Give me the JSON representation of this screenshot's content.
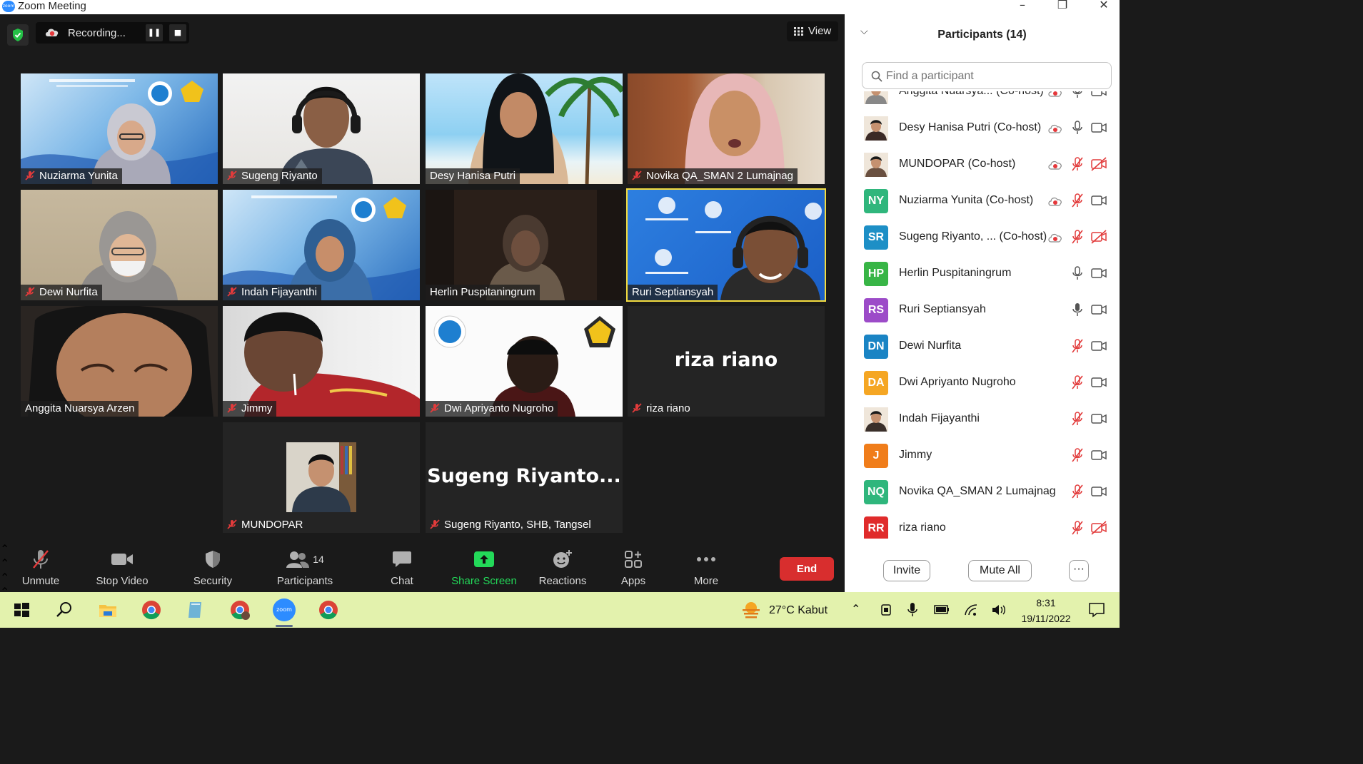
{
  "window": {
    "title": "Zoom Meeting",
    "logo_text": "zoom"
  },
  "meeting": {
    "recording_label": "Recording...",
    "view_label": "View",
    "tiles": [
      {
        "name": "Nuziarma Yunita",
        "muted": true
      },
      {
        "name": "Sugeng Riyanto",
        "muted": true
      },
      {
        "name": "Desy Hanisa Putri",
        "muted": false
      },
      {
        "name": "Novika QA_SMAN 2 Lumajnag",
        "muted": true
      },
      {
        "name": "Dewi Nurfita",
        "muted": true
      },
      {
        "name": "Indah Fijayanthi",
        "muted": true
      },
      {
        "name": "Herlin Puspitaningrum",
        "muted": false
      },
      {
        "name": "Ruri Septiansyah",
        "muted": false,
        "active_speaker": true
      },
      {
        "name": "Anggita Nuarsya Arzen",
        "muted": false
      },
      {
        "name": "Jimmy",
        "muted": true
      },
      {
        "name": "Dwi Apriyanto Nugroho",
        "muted": true
      },
      {
        "name": "riza riano",
        "muted": true,
        "big_label": "riza riano"
      },
      {
        "name": "MUNDOPAR",
        "muted": true
      },
      {
        "name": "Sugeng Riyanto, SHB, Tangsel",
        "muted": true,
        "big_label": "Sugeng  Riyanto..."
      }
    ]
  },
  "toolbar": {
    "unmute": "Unmute",
    "stop_video": "Stop Video",
    "security": "Security",
    "participants": "Participants",
    "participants_count": "14",
    "chat": "Chat",
    "share_screen": "Share Screen",
    "reactions": "Reactions",
    "apps": "Apps",
    "more": "More",
    "end": "End",
    "share_color": "#23d959",
    "end_color": "#d82e2e"
  },
  "panel": {
    "title": "Participants (14)",
    "search_placeholder": "Find a participant",
    "participants": [
      {
        "name": "Anggita Nuarsya...  (Co-host)",
        "initials": "",
        "color": "#888888",
        "photo": true,
        "mic": "on",
        "video": "on",
        "rec": true
      },
      {
        "name": "Desy Hanisa Putri (Co-host)",
        "initials": "",
        "color": "#3b2a26",
        "photo": true,
        "mic": "on",
        "video": "on",
        "rec": true
      },
      {
        "name": "MUNDOPAR (Co-host)",
        "initials": "",
        "color": "#6a5040",
        "photo": true,
        "mic": "muted",
        "video": "off",
        "rec": true
      },
      {
        "name": "Nuziarma Yunita (Co-host)",
        "initials": "NY",
        "color": "#2fb67c",
        "photo": false,
        "mic": "muted",
        "video": "on",
        "rec": true
      },
      {
        "name": "Sugeng Riyanto, ...  (Co-host)",
        "initials": "SR",
        "color": "#1d8fc6",
        "photo": false,
        "mic": "muted",
        "video": "off",
        "rec": true
      },
      {
        "name": "Herlin Puspitaningrum",
        "initials": "HP",
        "color": "#38b546",
        "photo": false,
        "mic": "on",
        "video": "on",
        "rec": false
      },
      {
        "name": "Ruri Septiansyah",
        "initials": "RS",
        "color": "#9c4bc8",
        "photo": false,
        "mic": "speaking",
        "video": "on",
        "rec": false
      },
      {
        "name": "Dewi Nurfita",
        "initials": "DN",
        "color": "#1a84c4",
        "photo": false,
        "mic": "muted",
        "video": "on",
        "rec": false
      },
      {
        "name": "Dwi Apriyanto Nugroho",
        "initials": "DA",
        "color": "#f5a623",
        "photo": false,
        "mic": "muted",
        "video": "on",
        "rec": false
      },
      {
        "name": "Indah Fijayanthi",
        "initials": "",
        "color": "#3a2f2a",
        "photo": true,
        "mic": "muted",
        "video": "on",
        "rec": false
      },
      {
        "name": "Jimmy",
        "initials": "J",
        "color": "#f07d1a",
        "photo": false,
        "mic": "muted",
        "video": "on",
        "rec": false
      },
      {
        "name": "Novika QA_SMAN 2 Lumajnag",
        "initials": "NQ",
        "color": "#2fb67c",
        "photo": false,
        "mic": "muted",
        "video": "on",
        "rec": false
      },
      {
        "name": "riza riano",
        "initials": "RR",
        "color": "#e02b2b",
        "photo": false,
        "mic": "muted",
        "video": "off",
        "rec": false
      }
    ],
    "invite": "Invite",
    "mute_all": "Mute All",
    "more": "···"
  },
  "taskbar": {
    "weather": "27°C  Kabut",
    "time": "8:31",
    "date": "19/11/2022",
    "zoom_text": "zoom"
  }
}
